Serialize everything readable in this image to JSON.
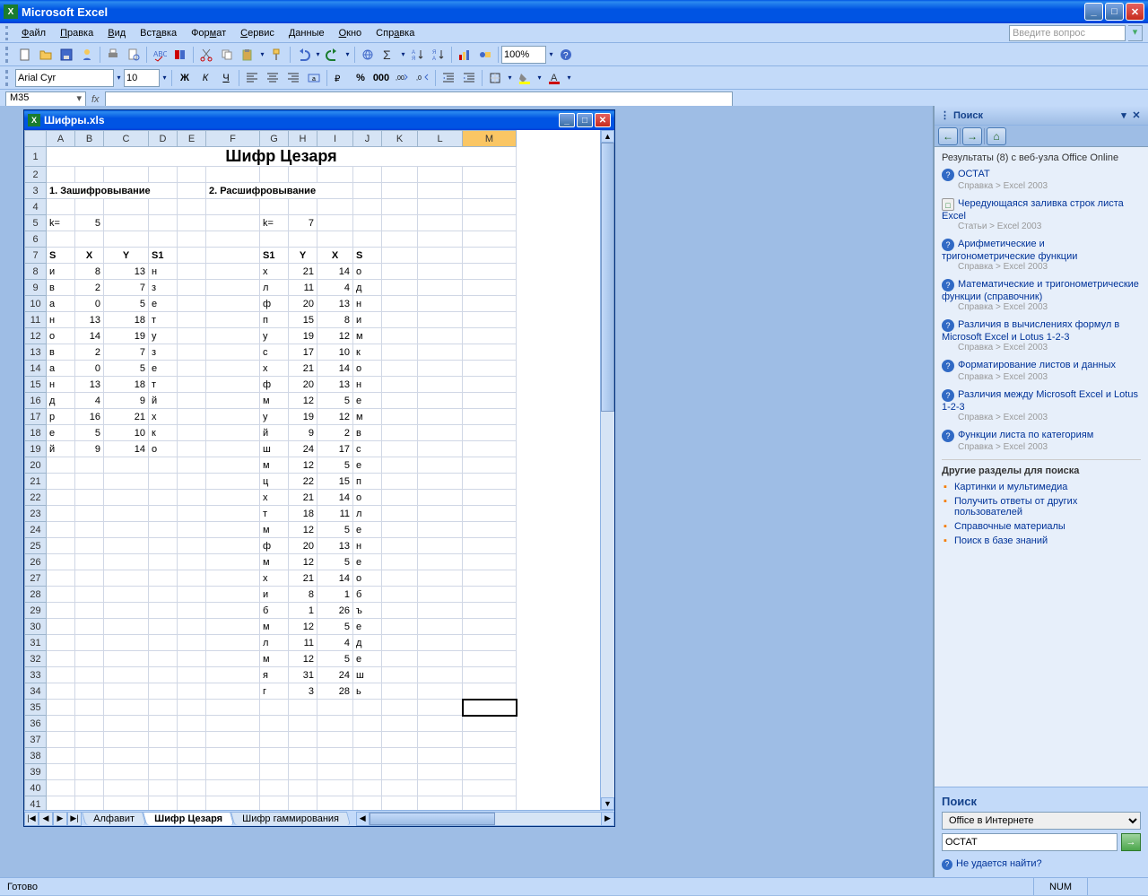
{
  "app": {
    "title": "Microsoft Excel"
  },
  "menu": [
    "Файл",
    "Правка",
    "Вид",
    "Вставка",
    "Формат",
    "Сервис",
    "Данные",
    "Окно",
    "Справка"
  ],
  "question_placeholder": "Введите вопрос",
  "formatting": {
    "font": "Arial Cyr",
    "size": "10",
    "zoom": "100%"
  },
  "namebox": "M35",
  "workbook": {
    "title": "Шифры.xls",
    "columns": [
      "A",
      "B",
      "C",
      "D",
      "E",
      "F",
      "G",
      "H",
      "I",
      "J",
      "K",
      "L",
      "M"
    ],
    "title_row": "Шифр Цезаря",
    "sec1": "1. Зашифровывание",
    "sec2": "2. Расшифровывание",
    "klabel": "k=",
    "k1": "5",
    "k2": "7",
    "hdr": {
      "s": "S",
      "x": "X",
      "y": "Y",
      "s1": "S1"
    },
    "encrypt": [
      {
        "s": "и",
        "x": "8",
        "y": "13",
        "s1": "н"
      },
      {
        "s": "в",
        "x": "2",
        "y": "7",
        "s1": "з"
      },
      {
        "s": "а",
        "x": "0",
        "y": "5",
        "s1": "е"
      },
      {
        "s": "н",
        "x": "13",
        "y": "18",
        "s1": "т"
      },
      {
        "s": "о",
        "x": "14",
        "y": "19",
        "s1": "у"
      },
      {
        "s": "в",
        "x": "2",
        "y": "7",
        "s1": "з"
      },
      {
        "s": "а",
        "x": "0",
        "y": "5",
        "s1": "е"
      },
      {
        "s": "н",
        "x": "13",
        "y": "18",
        "s1": "т"
      },
      {
        "s": "д",
        "x": "4",
        "y": "9",
        "s1": "й"
      },
      {
        "s": "р",
        "x": "16",
        "y": "21",
        "s1": "х"
      },
      {
        "s": "е",
        "x": "5",
        "y": "10",
        "s1": "к"
      },
      {
        "s": "й",
        "x": "9",
        "y": "14",
        "s1": "о"
      }
    ],
    "decrypt": [
      {
        "s1": "х",
        "y": "21",
        "x": "14",
        "s": "о"
      },
      {
        "s1": "л",
        "y": "11",
        "x": "4",
        "s": "д"
      },
      {
        "s1": "ф",
        "y": "20",
        "x": "13",
        "s": "н"
      },
      {
        "s1": "п",
        "y": "15",
        "x": "8",
        "s": "и"
      },
      {
        "s1": "у",
        "y": "19",
        "x": "12",
        "s": "м"
      },
      {
        "s1": "с",
        "y": "17",
        "x": "10",
        "s": "к"
      },
      {
        "s1": "х",
        "y": "21",
        "x": "14",
        "s": "о"
      },
      {
        "s1": "ф",
        "y": "20",
        "x": "13",
        "s": "н"
      },
      {
        "s1": "м",
        "y": "12",
        "x": "5",
        "s": "е"
      },
      {
        "s1": "у",
        "y": "19",
        "x": "12",
        "s": "м"
      },
      {
        "s1": "й",
        "y": "9",
        "x": "2",
        "s": "в"
      },
      {
        "s1": "ш",
        "y": "24",
        "x": "17",
        "s": "с"
      },
      {
        "s1": "м",
        "y": "12",
        "x": "5",
        "s": "е"
      },
      {
        "s1": "ц",
        "y": "22",
        "x": "15",
        "s": "п"
      },
      {
        "s1": "х",
        "y": "21",
        "x": "14",
        "s": "о"
      },
      {
        "s1": "т",
        "y": "18",
        "x": "11",
        "s": "л"
      },
      {
        "s1": "м",
        "y": "12",
        "x": "5",
        "s": "е"
      },
      {
        "s1": "ф",
        "y": "20",
        "x": "13",
        "s": "н"
      },
      {
        "s1": "м",
        "y": "12",
        "x": "5",
        "s": "е"
      },
      {
        "s1": "х",
        "y": "21",
        "x": "14",
        "s": "о"
      },
      {
        "s1": "и",
        "y": "8",
        "x": "1",
        "s": "б"
      },
      {
        "s1": "б",
        "y": "1",
        "x": "26",
        "s": "ъ"
      },
      {
        "s1": "м",
        "y": "12",
        "x": "5",
        "s": "е"
      },
      {
        "s1": "л",
        "y": "11",
        "x": "4",
        "s": "д"
      },
      {
        "s1": "м",
        "y": "12",
        "x": "5",
        "s": "е"
      },
      {
        "s1": "я",
        "y": "31",
        "x": "24",
        "s": "ш"
      },
      {
        "s1": "г",
        "y": "3",
        "x": "28",
        "s": "ь"
      }
    ],
    "tabs": [
      "Алфавит",
      "Шифр Цезаря",
      "Шифр гаммирования"
    ],
    "active_tab": 1,
    "active_cell": "M35"
  },
  "taskpane": {
    "title": "Поиск",
    "results_label": "Результаты (8) с веб-узла Office Online",
    "results": [
      {
        "type": "help",
        "title": "ОСТАТ",
        "path": "Справка > Excel 2003"
      },
      {
        "type": "doc",
        "title": "Чередующаяся заливка строк листа Excel",
        "path": "Статьи > Excel 2003"
      },
      {
        "type": "help",
        "title": "Арифметические и тригонометрические функции",
        "path": "Справка > Excel 2003"
      },
      {
        "type": "help",
        "title": "Математические и тригонометрические функции (справочник)",
        "path": "Справка > Excel 2003"
      },
      {
        "type": "help",
        "title": "Различия в вычислениях формул в Microsoft Excel и Lotus 1-2-3",
        "path": "Справка > Excel 2003"
      },
      {
        "type": "help",
        "title": "Форматирование листов и данных",
        "path": "Справка > Excel 2003"
      },
      {
        "type": "help",
        "title": "Различия между Microsoft Excel и Lotus 1-2-3",
        "path": "Справка > Excel 2003"
      },
      {
        "type": "help",
        "title": "Функции листа по категориям",
        "path": "Справка > Excel 2003"
      }
    ],
    "other_section": "Другие разделы для поиска",
    "other_links": [
      "Картинки и мультимедиа",
      "Получить ответы от других пользователей",
      "Справочные материалы",
      "Поиск в базе знаний"
    ],
    "footer": {
      "label": "Поиск",
      "scope": "Office в Интернете",
      "query": "ОСТАТ",
      "cantfind": "Не удается найти?"
    }
  },
  "status": {
    "ready": "Готово",
    "num": "NUM"
  }
}
